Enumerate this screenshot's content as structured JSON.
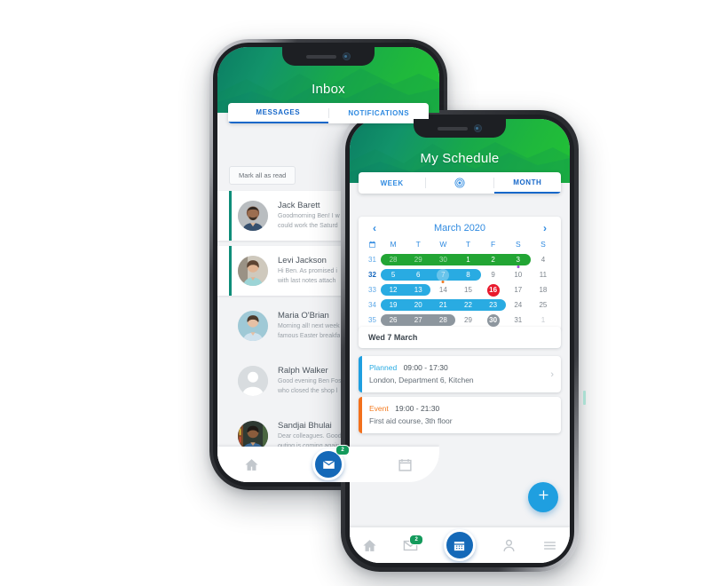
{
  "inbox_phone": {
    "header": {
      "title": "Inbox"
    },
    "tabs": [
      {
        "label": "MESSAGES",
        "active": true
      },
      {
        "label": "NOTIFICATIONS",
        "active": false
      }
    ],
    "mark_all_label": "Mark all as read",
    "messages": [
      {
        "name": "Jack Barett",
        "line1": "Goodmorning Ben! I w",
        "line2": "could work the Saturd",
        "unread": true,
        "avatar": "photo-man-beard"
      },
      {
        "name": "Levi Jackson",
        "line1": "Hi Ben. As promised i",
        "line2": "with last notes attach",
        "unread": true,
        "avatar": "photo-woman-light"
      },
      {
        "name": "Maria O'Brian",
        "line1": "Morning all! next week",
        "line2": "famous Easter breakfa",
        "unread": false,
        "avatar": "photo-woman-blue"
      },
      {
        "name": "Ralph Walker",
        "line1": "Good evening Ben Fos",
        "line2": "who closed the shop l",
        "unread": false,
        "avatar": "placeholder-person"
      },
      {
        "name": "Sandjai Bhulai",
        "line1": "Dear colleagues. Good",
        "line2": "outing is coming again",
        "unread": false,
        "avatar": "photo-man-shelves"
      }
    ],
    "nav": [
      {
        "icon": "home-icon",
        "active": false,
        "badge": null
      },
      {
        "icon": "mail-icon",
        "active": true,
        "badge": "2"
      },
      {
        "icon": "calendar-icon",
        "active": false,
        "badge": null
      }
    ]
  },
  "schedule_phone": {
    "header": {
      "title": "My Schedule"
    },
    "view_tabs": [
      {
        "label": "WEEK",
        "active": false
      },
      {
        "label": "",
        "active": false,
        "icon": "target-icon"
      },
      {
        "label": "MONTH",
        "active": true
      }
    ],
    "calendar": {
      "prev_label": "‹",
      "next_label": "›",
      "month_label": "March 2020",
      "week_icon": "calendar-icon",
      "day_headers": [
        "M",
        "T",
        "W",
        "T",
        "F",
        "S",
        "S"
      ],
      "week_numbers": [
        "31",
        "32",
        "33",
        "34",
        "35"
      ],
      "active_week": "32",
      "colors": {
        "green": "#22a534",
        "blue": "#29abe2",
        "gray": "#8d969e",
        "red": "#e8192c",
        "accent_text": "#2f8ae0"
      },
      "rows": [
        {
          "week": "31",
          "days": [
            "28",
            "29",
            "30",
            "1",
            "2",
            "3",
            "4"
          ],
          "muted": [
            true,
            true,
            true,
            false,
            false,
            false,
            false
          ],
          "pill": {
            "color": "green",
            "start": 0,
            "end": 5
          },
          "dot": {
            "index": 5,
            "color": "#a44bd6"
          }
        },
        {
          "week": "32",
          "days": [
            "5",
            "6",
            "7",
            "8",
            "9",
            "10",
            "11"
          ],
          "muted": [
            false,
            false,
            false,
            false,
            false,
            false,
            false
          ],
          "pill": {
            "color": "blue",
            "start": 0,
            "end": 3
          },
          "today": 2,
          "dot": {
            "index": 2,
            "color": "#f07820"
          }
        },
        {
          "week": "33",
          "days": [
            "12",
            "13",
            "14",
            "15",
            "16",
            "17",
            "18"
          ],
          "muted": [
            false,
            false,
            false,
            false,
            false,
            false,
            false
          ],
          "pill": {
            "color": "blue",
            "start": 0,
            "end": 1
          },
          "circle": {
            "index": 4,
            "color": "red"
          }
        },
        {
          "week": "34",
          "days": [
            "19",
            "20",
            "21",
            "22",
            "23",
            "24",
            "25"
          ],
          "muted": [
            false,
            false,
            false,
            false,
            false,
            false,
            false
          ],
          "pill": {
            "color": "blue",
            "start": 0,
            "end": 4
          }
        },
        {
          "week": "35",
          "days": [
            "26",
            "27",
            "28",
            "29",
            "30",
            "31",
            "1"
          ],
          "muted": [
            false,
            false,
            false,
            false,
            false,
            false,
            true
          ],
          "pill": {
            "color": "gray",
            "start": 0,
            "end": 2
          },
          "circle": {
            "index": 4,
            "color": "gray"
          }
        }
      ]
    },
    "day_label": "Wed 7 March",
    "events": [
      {
        "kind": "Planned",
        "kind_color": "#29abe2",
        "time": "09:00 - 17:30",
        "detail": "London, Department 6, Kitchen",
        "stripe": "#1f9fe0",
        "chevron": true
      },
      {
        "kind": "Event",
        "kind_color": "#f47b20",
        "time": "19:00 - 21:30",
        "detail": "First aid course, 3th floor",
        "stripe": "#f2701c",
        "chevron": false
      }
    ],
    "fab": {
      "icon": "plus-icon",
      "color": "#1f9fe0"
    },
    "nav": [
      {
        "icon": "home-icon",
        "active": false,
        "badge": null
      },
      {
        "icon": "mail-icon",
        "active": false,
        "badge": "2"
      },
      {
        "icon": "calendar-icon",
        "active": true,
        "badge": null
      },
      {
        "icon": "person-icon",
        "active": false,
        "badge": null
      },
      {
        "icon": "menu-icon",
        "active": false,
        "badge": null
      }
    ]
  }
}
